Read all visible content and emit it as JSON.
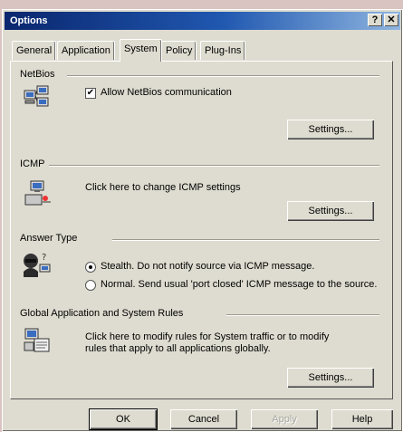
{
  "window": {
    "title": "Options",
    "help_glyph": "?",
    "close_glyph": "✕"
  },
  "tabs": [
    {
      "label": "General",
      "active": false
    },
    {
      "label": "Application",
      "active": false
    },
    {
      "label": "System",
      "active": true
    },
    {
      "label": "Policy",
      "active": false
    },
    {
      "label": "Plug-Ins",
      "active": false
    }
  ],
  "netbios": {
    "title": "NetBios",
    "checkbox_label": "Allow NetBios communication",
    "checked": true,
    "checkbox_glyph": "✔",
    "settings_label": "Settings..."
  },
  "icmp": {
    "title": "ICMP",
    "description": "Click here to change ICMP settings",
    "settings_label": "Settings..."
  },
  "answer_type": {
    "title": "Answer Type",
    "options": [
      {
        "label": "Stealth. Do not notify source via ICMP message.",
        "selected": true
      },
      {
        "label": "Normal. Send usual 'port closed' ICMP message to the source.",
        "selected": false
      }
    ]
  },
  "global_rules": {
    "title": "Global Application and System Rules",
    "description_line1": "Click here to modify rules for System traffic or to modify",
    "description_line2": "rules that apply to all applications globally.",
    "settings_label": "Settings..."
  },
  "footer": {
    "ok_label": "OK",
    "cancel_label": "Cancel",
    "apply_label": "Apply",
    "help_label": "Help"
  }
}
